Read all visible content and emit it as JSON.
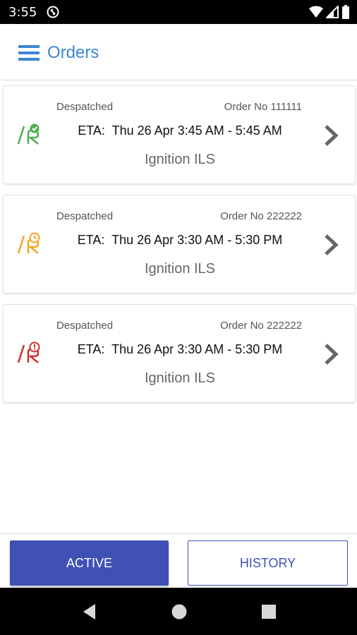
{
  "status_bar": {
    "time": "3:55",
    "icons": [
      "data-saver-icon",
      "wifi-icon",
      "cell-signal-icon",
      "battery-icon"
    ]
  },
  "app_bar": {
    "menu_icon": "hamburger-menu-icon",
    "title": "Orders",
    "title_color": "#3b86d6"
  },
  "orders": [
    {
      "status": "Despatched",
      "order_no": "Order No 111111",
      "eta": "ETA:  Thu 26 Apr 3:45 AM - 5:45 AM",
      "vendor": "Ignition ILS",
      "status_icon": "on-time-check-icon",
      "status_color": "#4caf50"
    },
    {
      "status": "Despatched",
      "order_no": "Order No 222222",
      "eta": "ETA:  Thu 26 Apr 3:30 AM - 5:30 PM",
      "vendor": "Ignition ILS",
      "status_icon": "pending-clock-icon",
      "status_color": "#f5a623"
    },
    {
      "status": "Despatched",
      "order_no": "Order No 222222",
      "eta": "ETA:  Thu 26 Apr 3:30 AM - 5:30 PM",
      "vendor": "Ignition ILS",
      "status_icon": "alert-exclamation-icon",
      "status_color": "#d32f2f"
    }
  ],
  "tabs": {
    "active_label": "ACTIVE",
    "history_label": "HISTORY",
    "accent_color": "#3f51b5"
  },
  "nav_bar": {
    "icons": [
      "back-icon",
      "home-icon",
      "recents-icon"
    ]
  }
}
